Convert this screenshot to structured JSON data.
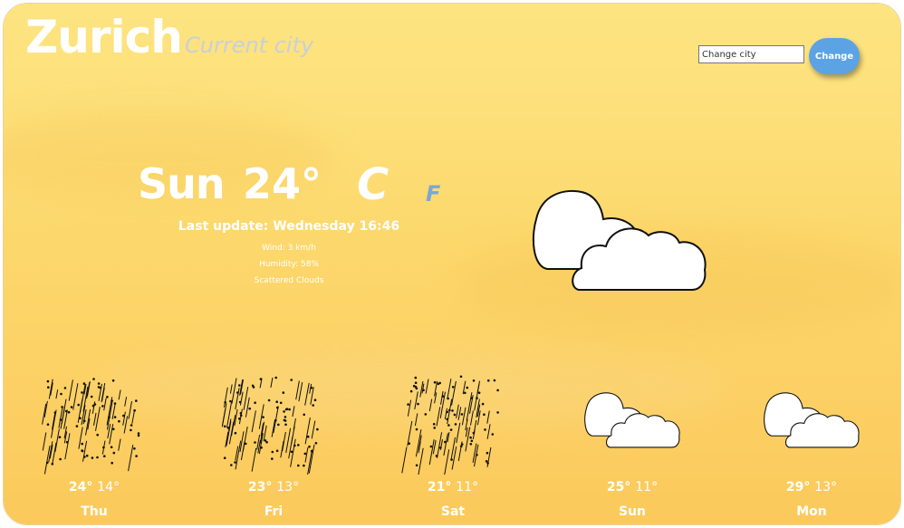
{
  "header": {
    "city": "Zurich",
    "subtitle": "Current city",
    "search_placeholder": "Change city",
    "change_label": "Change"
  },
  "current": {
    "day": "Sun",
    "temperature": "24°",
    "unit_celsius": "C",
    "unit_fahrenheit": "F",
    "last_update": "Last update: Wednesday 16:46",
    "wind": "Wind: 3 km/h",
    "humidity": "Humidity: 58%",
    "description": "Scattered Clouds",
    "icon": "scattered-clouds-icon"
  },
  "forecast": [
    {
      "day": "Thu",
      "high": "24°",
      "low": "14°",
      "icon": "rain-icon"
    },
    {
      "day": "Fri",
      "high": "23°",
      "low": "13°",
      "icon": "rain-icon"
    },
    {
      "day": "Sat",
      "high": "21°",
      "low": "11°",
      "icon": "rain-icon"
    },
    {
      "day": "Sun",
      "high": "25°",
      "low": "11°",
      "icon": "clouds-icon"
    },
    {
      "day": "Mon",
      "high": "29°",
      "low": "13°",
      "icon": "clouds-icon"
    }
  ],
  "colors": {
    "background_top": "#fde481",
    "background_bottom": "#fbc95b",
    "button": "#5ba3e4",
    "fahrenheit": "#79a9d3",
    "subtitle": "#c8cfdc"
  }
}
